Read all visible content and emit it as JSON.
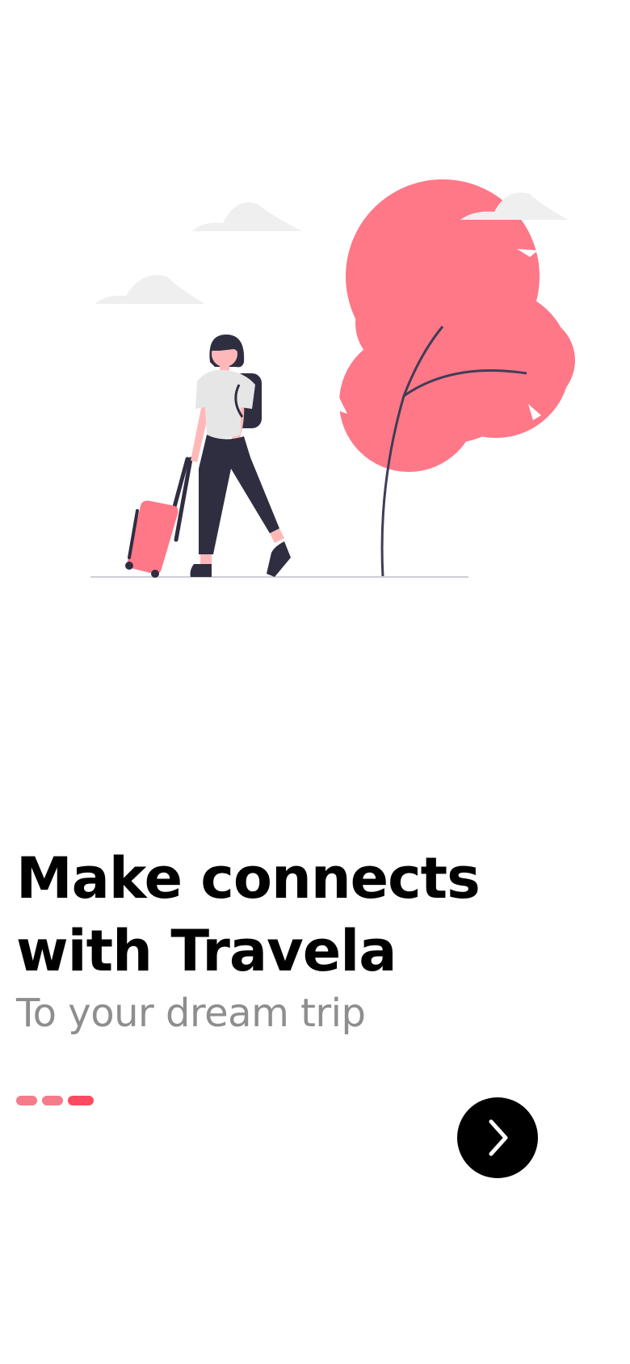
{
  "onboarding": {
    "headline_line1": "Make connects",
    "headline_line2": "with Travela",
    "subtitle": "To your dream trip",
    "pager": {
      "total": 3,
      "active_index": 2,
      "inactive_color": "#f47c8a",
      "active_color": "#ff4a5f"
    },
    "next_button": {
      "icon": "chevron-right-icon",
      "background": "#000000",
      "icon_color": "#ffffff"
    },
    "illustration": {
      "subject": "traveler-with-suitcase-and-tree",
      "accent_color": "#ff7888",
      "dark_color": "#2f2e41",
      "cloud_color": "#f2f2f2"
    }
  }
}
